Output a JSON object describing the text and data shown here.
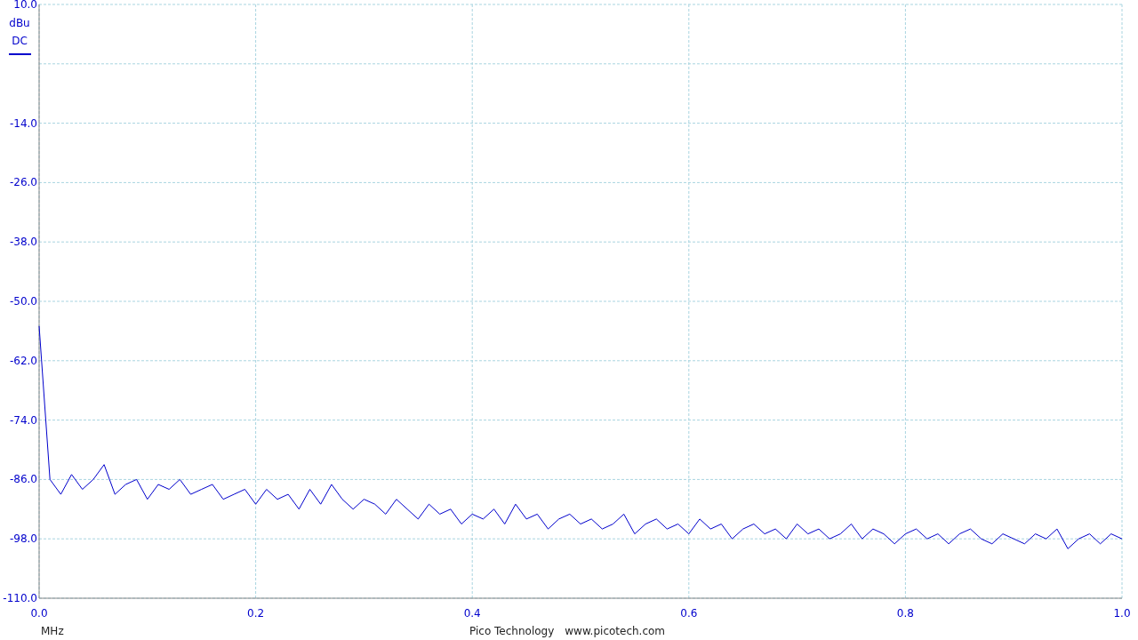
{
  "channel": {
    "unit": "dBu",
    "coupling": "DC",
    "color": "#0000cc"
  },
  "chart_data": {
    "type": "line",
    "xlabel": "MHz",
    "xlim": [
      0,
      1
    ],
    "ylim": [
      -110,
      10
    ],
    "xticks": [
      {
        "value": 0,
        "label": "0.0"
      },
      {
        "value": 0.2,
        "label": "0.2"
      },
      {
        "value": 0.4,
        "label": "0.4"
      },
      {
        "value": 0.6,
        "label": "0.6"
      },
      {
        "value": 0.8,
        "label": "0.8"
      },
      {
        "value": 1,
        "label": "1.0"
      }
    ],
    "yticks": [
      {
        "value": 10,
        "label": "10.0"
      },
      {
        "value": -14,
        "label": "-14.0"
      },
      {
        "value": -26,
        "label": "-26.0"
      },
      {
        "value": -38,
        "label": "-38.0"
      },
      {
        "value": -50,
        "label": "-50.0"
      },
      {
        "value": -62,
        "label": "-62.0"
      },
      {
        "value": -74,
        "label": "-74.0"
      },
      {
        "value": -86,
        "label": "-86.0"
      },
      {
        "value": -98,
        "label": "-98.0"
      },
      {
        "value": -110,
        "label": "-110.0"
      }
    ],
    "grid": true,
    "x": [
      0,
      0.01,
      0.02,
      0.03,
      0.04,
      0.05,
      0.06,
      0.07,
      0.08,
      0.09,
      0.1,
      0.11,
      0.12,
      0.13,
      0.14,
      0.15,
      0.16,
      0.17,
      0.18,
      0.19,
      0.2,
      0.21,
      0.22,
      0.23,
      0.24,
      0.25,
      0.26,
      0.27,
      0.28,
      0.29,
      0.3,
      0.31,
      0.32,
      0.33,
      0.34,
      0.35,
      0.36,
      0.37,
      0.38,
      0.39,
      0.4,
      0.41,
      0.42,
      0.43,
      0.44,
      0.45,
      0.46,
      0.47,
      0.48,
      0.49,
      0.5,
      0.51,
      0.52,
      0.53,
      0.54,
      0.55,
      0.56,
      0.57,
      0.58,
      0.59,
      0.6,
      0.61,
      0.62,
      0.63,
      0.64,
      0.65,
      0.66,
      0.67,
      0.68,
      0.69,
      0.7,
      0.71,
      0.72,
      0.73,
      0.74,
      0.75,
      0.76,
      0.77,
      0.78,
      0.79,
      0.8,
      0.81,
      0.82,
      0.83,
      0.84,
      0.85,
      0.86,
      0.87,
      0.88,
      0.89,
      0.9,
      0.91,
      0.92,
      0.93,
      0.94,
      0.95,
      0.96,
      0.97,
      0.98,
      0.99,
      1
    ],
    "series": [
      {
        "color": "#0000cc",
        "values": [
          -55,
          -86,
          -89,
          -85,
          -88,
          -86,
          -83,
          -89,
          -87,
          -86,
          -90,
          -87,
          -88,
          -86,
          -89,
          -88,
          -87,
          -90,
          -89,
          -88,
          -91,
          -88,
          -90,
          -89,
          -92,
          -88,
          -91,
          -87,
          -90,
          -92,
          -90,
          -91,
          -93,
          -90,
          -92,
          -94,
          -91,
          -93,
          -92,
          -95,
          -93,
          -94,
          -92,
          -95,
          -91,
          -94,
          -93,
          -96,
          -94,
          -93,
          -95,
          -94,
          -96,
          -95,
          -93,
          -97,
          -95,
          -94,
          -96,
          -95,
          -97,
          -94,
          -96,
          -95,
          -98,
          -96,
          -95,
          -97,
          -96,
          -98,
          -95,
          -97,
          -96,
          -98,
          -97,
          -95,
          -98,
          -96,
          -97,
          -99,
          -97,
          -96,
          -98,
          -97,
          -99,
          -97,
          -96,
          -98,
          -99,
          -97,
          -98,
          -99,
          -97,
          -98,
          -96,
          -100,
          -98,
          -97,
          -99,
          -97,
          -98
        ]
      }
    ]
  },
  "footer": {
    "company": "Pico Technology",
    "website": "www.picotech.com"
  }
}
